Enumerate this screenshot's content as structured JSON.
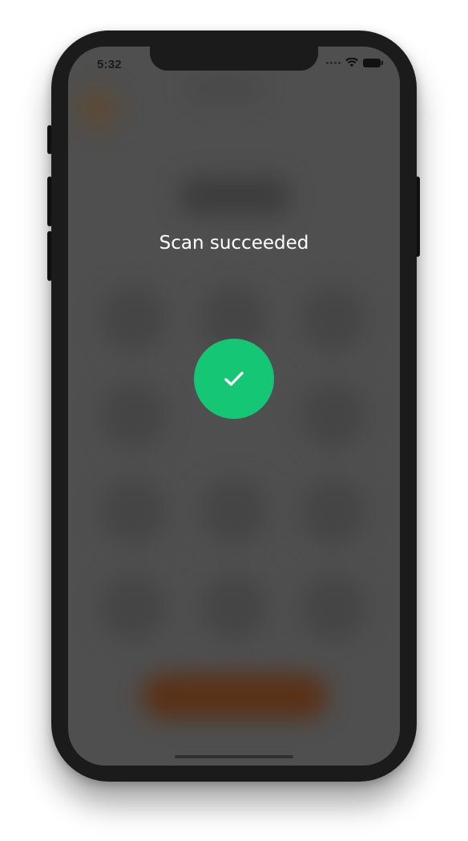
{
  "status_bar": {
    "time": "5:32",
    "wifi_icon": "wifi-icon",
    "battery_icon": "battery-icon",
    "signal_icon": "signal-dots-icon"
  },
  "overlay": {
    "title": "Scan succeeded",
    "icon": "checkmark-icon",
    "success_color": "#15c674",
    "dim_color": "#4f4f4f"
  },
  "background": {
    "action_button_color": "#5a3118"
  }
}
